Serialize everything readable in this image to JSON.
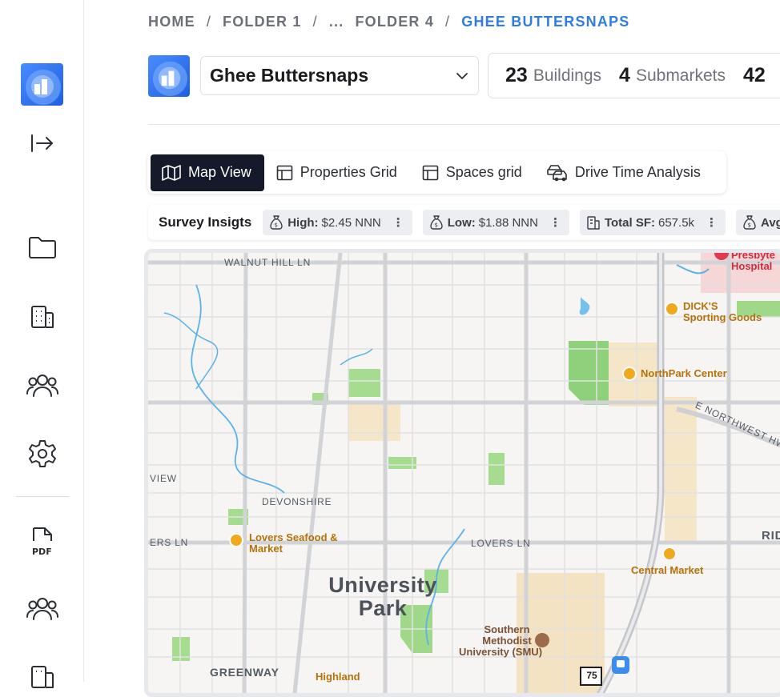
{
  "breadcrumb": {
    "home": "HOME",
    "folder1": "FOLDER 1",
    "ellipsis": "...",
    "folder4": "FOLDER 4",
    "current": "GHEE BUTTERSNAPS",
    "separator": "/"
  },
  "project": {
    "name": "Ghee Buttersnaps"
  },
  "stats": {
    "buildings_count": "23",
    "buildings_label": "Buildings",
    "submarkets_count": "4",
    "submarkets_label": "Submarkets",
    "third_count": "42"
  },
  "tabs": [
    {
      "label": "Map View",
      "icon": "map-icon",
      "active": true
    },
    {
      "label": "Properties Grid",
      "icon": "grid-icon"
    },
    {
      "label": "Spaces grid",
      "icon": "grid-icon"
    },
    {
      "label": "Drive Time Analysis",
      "icon": "car-icon"
    }
  ],
  "insights": {
    "title": "Survey Insigts",
    "chips": [
      {
        "key": "High:",
        "value": "$2.45 NNN",
        "icon": "money-bag-icon"
      },
      {
        "key": "Low:",
        "value": "$1.88 NNN",
        "icon": "money-bag-icon"
      },
      {
        "key": "Total SF:",
        "value": "657.5k",
        "icon": "building-icon"
      },
      {
        "key": "Avg",
        "value": "",
        "icon": "money-bag-icon"
      }
    ],
    "more_glyph": "⋮"
  },
  "map": {
    "streets": {
      "walnut_hill": "WALNUT HILL LN",
      "devonshire": "DEVONSHIRE",
      "lovers_left": "ERS LN",
      "lovers_center": "LOVERS LN",
      "view": "VIEW",
      "northwest_hwy": "E NORTHWEST HWY",
      "greenway": "GREENWAY",
      "ridge": "RID",
      "highway": "75"
    },
    "places": {
      "university_park_1": "University",
      "university_park_2": "Park",
      "dicks_1": "DICK'S",
      "dicks_2": "Sporting Goods",
      "northpark": "NorthPark Center",
      "lovers_seafood_1": "Lovers Seafood &",
      "lovers_seafood_2": "Market",
      "central_market": "Central Market",
      "smu_1": "Southern",
      "smu_2": "Methodist",
      "smu_3": "University (SMU)",
      "presbyterian_1": "Presbyte",
      "presbyterian_2": "Hospital",
      "highland": "Highland"
    }
  },
  "colors": {
    "accent": "#2f7de1",
    "active_tab": "#141a29",
    "poi": "#f2a81d",
    "park": "#8fd17a",
    "water": "#59b3e8"
  }
}
